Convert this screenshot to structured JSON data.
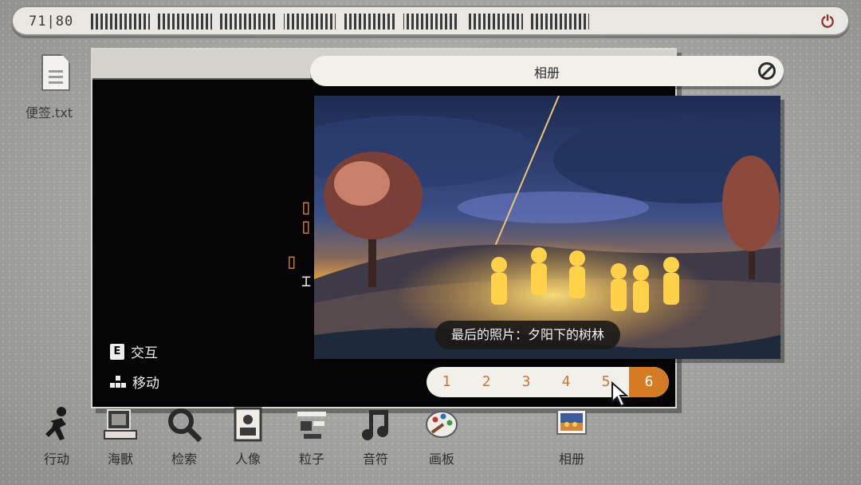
{
  "status_bar": {
    "counter": "71|80",
    "power_icon": "power-icon"
  },
  "desktop": {
    "file_label": "便签.txt"
  },
  "terminal": {
    "hints": [
      {
        "key": "E",
        "label": "交互"
      },
      {
        "key": "",
        "label": "移动"
      }
    ]
  },
  "album": {
    "title": "相册",
    "caption": "最后的照片：夕阳下的树林",
    "pages": [
      "1",
      "2",
      "3",
      "4",
      "5",
      "6"
    ],
    "active_page": "6"
  },
  "dock": {
    "items": [
      {
        "label": "行动",
        "icon": "running-person-icon"
      },
      {
        "label": "海獸",
        "icon": "computer-icon"
      },
      {
        "label": "检索",
        "icon": "magnifier-icon"
      },
      {
        "label": "人像",
        "icon": "portrait-icon"
      },
      {
        "label": "粒子",
        "icon": "particle-icon"
      },
      {
        "label": "音符",
        "icon": "music-note-icon"
      },
      {
        "label": "画板",
        "icon": "palette-icon"
      },
      {
        "label": "相册",
        "icon": "photo-album-icon"
      }
    ]
  },
  "colors": {
    "accent": "#d57b24",
    "bar_bg": "#f2f0eb",
    "terminal_bg": "#050505"
  }
}
